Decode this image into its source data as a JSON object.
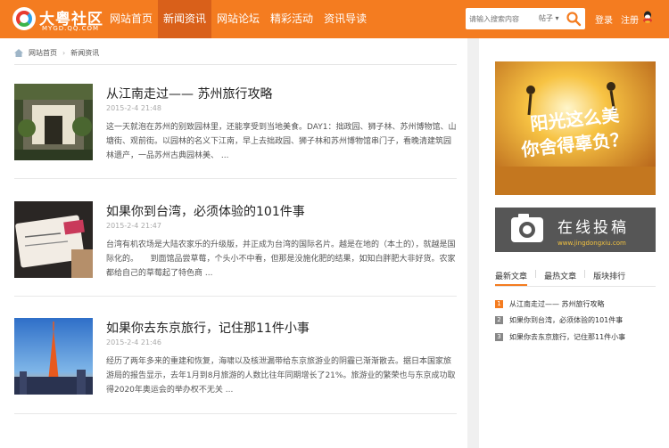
{
  "header": {
    "logo_text": "大粤社区",
    "logo_sub": "MYGD.QQ.COM",
    "nav": [
      {
        "label": "网站首页",
        "active": false
      },
      {
        "label": "新闻资讯",
        "active": true
      },
      {
        "label": "网站论坛",
        "active": false
      },
      {
        "label": "精彩活动",
        "active": false
      },
      {
        "label": "资讯导读",
        "active": false
      }
    ],
    "search": {
      "placeholder": "请输入搜索内容",
      "select_value": "帖子"
    },
    "login": "登录",
    "register": "注册"
  },
  "breadcrumb": {
    "home": "网站首页",
    "current": "新闻资讯"
  },
  "articles": [
    {
      "title": "从江南走过—— 苏州旅行攻略",
      "date": "2015-2-4 21:48",
      "summary": "这一天就泡在苏州的别致园林里，还能享受到当地美食。DAY1：拙政园、狮子林、苏州博物馆、山塘街、观前街。以园林的名义下江南，早上去拙政园、狮子林和苏州博物馆串门子，看晚清建筑园林遗产，一品苏州古典园林美、 ..."
    },
    {
      "title": "如果你到台湾，必须体验的101件事",
      "date": "2015-2-4 21:47",
      "summary": "台湾有机农场是大陆农家乐的升级版，并正成为台湾的国际名片。越是在地的（本土的），就越是国际化的。　　到面馆品尝草莓，个头小不中看，但那是没施化肥的结果，如知白胖肥大非好货。农家都给自己的草莓起了特色商 ..."
    },
    {
      "title": "如果你去东京旅行，记住那11件小事",
      "date": "2015-2-4 21:46",
      "summary": "经历了两年多来的重建和恢复，海啸以及核泄漏带给东京旅游业的阴霾已渐渐散去。据日本国家旅游局的报告显示，去年1月到8月旅游的人数比往年同期增长了21%。旅游业的繁荣也与东京成功取得2020年奥运会的举办权不无关 ..."
    }
  ],
  "sidebar": {
    "banner1_text1": "阳光这么美",
    "banner1_text2": "你舍得辜负？",
    "banner2_text": "在线投稿",
    "banner2_url": "www.jingdongxiu.com",
    "tabs": [
      "最新文章",
      "最热文章",
      "版块排行"
    ],
    "ranks": [
      {
        "num": "1",
        "text": "从江南走过—— 苏州旅行攻略",
        "color": "#f47c20"
      },
      {
        "num": "2",
        "text": "如果你到台湾，必须体验的101件事",
        "color": "#888888"
      },
      {
        "num": "3",
        "text": "如果你去东京旅行，记住那11件小事",
        "color": "#888888"
      }
    ]
  },
  "colors": {
    "brand": "#f47c20",
    "nav_active": "#d9601a"
  }
}
